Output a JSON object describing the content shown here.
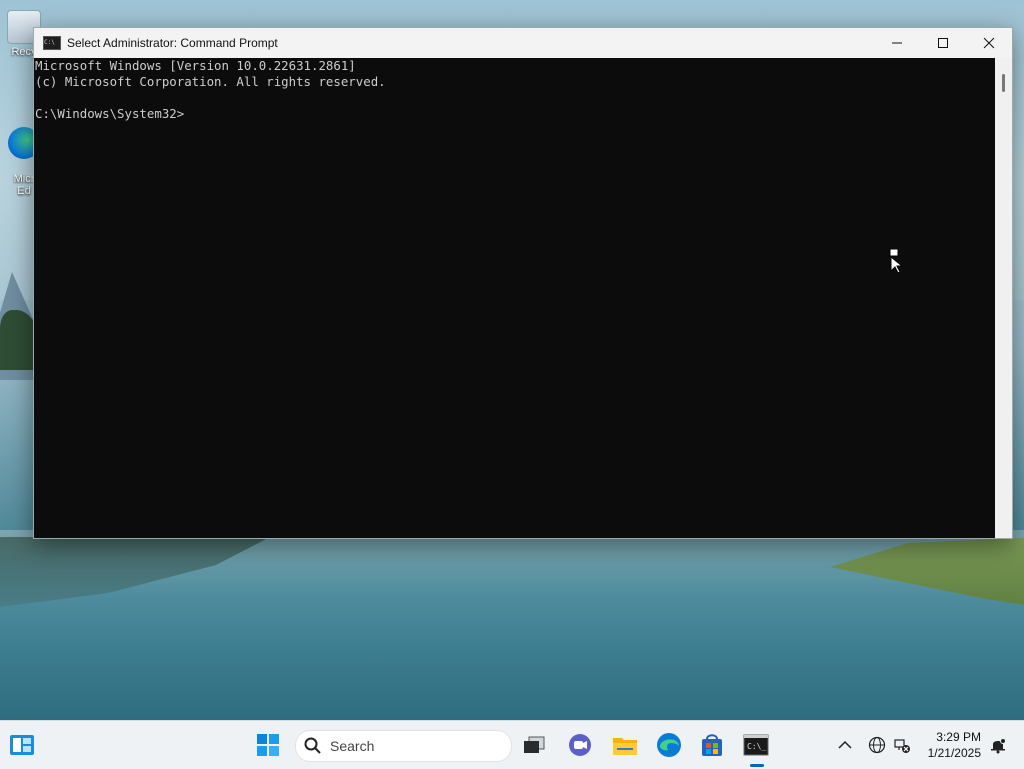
{
  "desktop": {
    "icons": [
      {
        "label": "Recy",
        "icon": "recycle-bin-icon"
      },
      {
        "label": "Micr\nEd",
        "icon": "edge-shortcut-icon"
      }
    ]
  },
  "window": {
    "title": "Select Administrator: Command Prompt",
    "icon": "cmd-icon",
    "controls": {
      "minimize": "–",
      "maximize": "□",
      "close": "✕"
    },
    "console_lines": [
      "Microsoft Windows [Version 10.0.22631.2861]",
      "(c) Microsoft Corporation. All rights reserved.",
      "",
      "C:\\Windows\\System32>"
    ]
  },
  "taskbar": {
    "search_placeholder": "Search",
    "apps": [
      "start-icon",
      "task-view-icon",
      "chat-icon",
      "file-explorer-icon",
      "edge-icon",
      "store-icon",
      "terminal-icon"
    ],
    "tray": {
      "time": "3:29 PM",
      "date": "1/21/2025"
    }
  },
  "colors": {
    "console_bg": "#0c0c0c",
    "console_text": "#cccccc",
    "accent": "#0067c0"
  }
}
